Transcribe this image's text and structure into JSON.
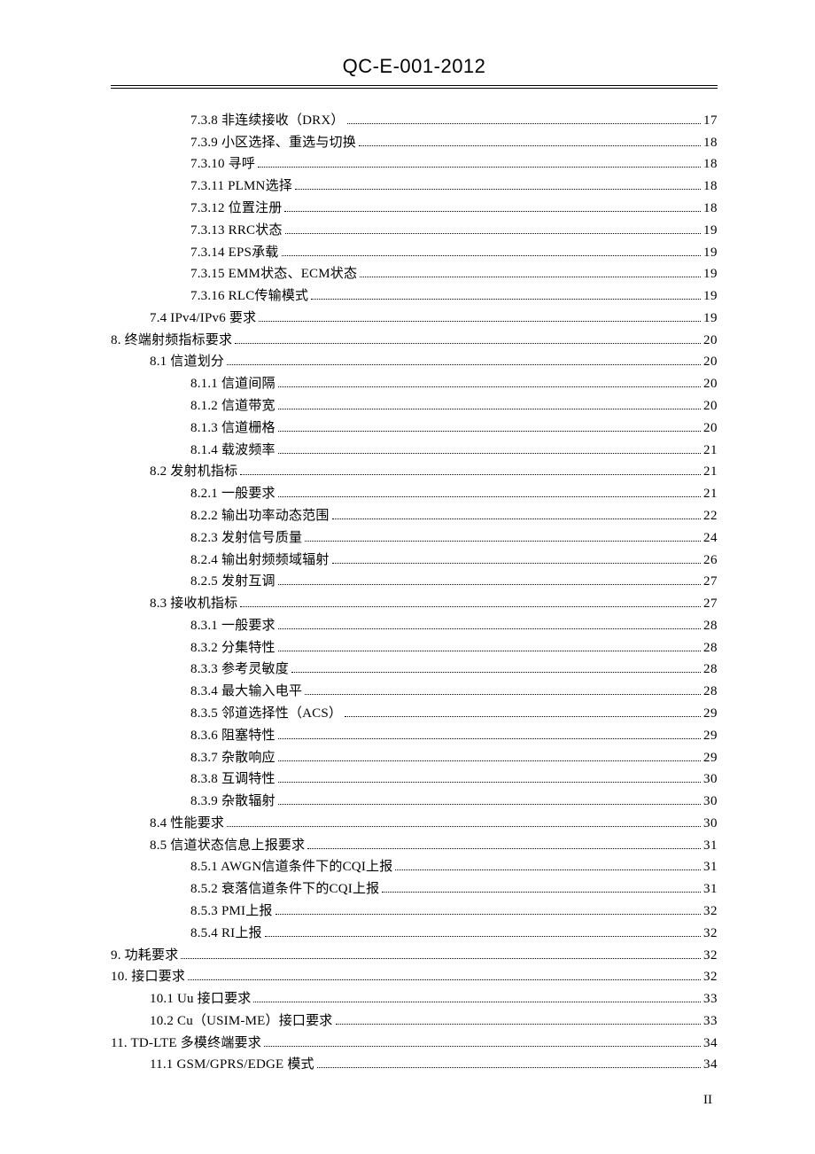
{
  "header": "QC-E-001-2012",
  "page_number": "II",
  "toc": [
    {
      "level": 3,
      "label": "7.3.8 非连续接收（DRX）",
      "page": "17"
    },
    {
      "level": 3,
      "label": "7.3.9 小区选择、重选与切换",
      "page": "18"
    },
    {
      "level": 3,
      "label": "7.3.10 寻呼",
      "page": "18"
    },
    {
      "level": 3,
      "label": "7.3.11 PLMN选择",
      "page": "18"
    },
    {
      "level": 3,
      "label": "7.3.12 位置注册",
      "page": "18"
    },
    {
      "level": 3,
      "label": "7.3.13 RRC状态",
      "page": "19"
    },
    {
      "level": 3,
      "label": "7.3.14 EPS承载",
      "page": "19"
    },
    {
      "level": 3,
      "label": "7.3.15 EMM状态、ECM状态",
      "page": "19"
    },
    {
      "level": 3,
      "label": "7.3.16 RLC传输模式",
      "page": "19"
    },
    {
      "level": 2,
      "label": "7.4 IPv4/IPv6 要求",
      "page": "19"
    },
    {
      "level": 1,
      "label": "8. 终端射频指标要求",
      "page": "20"
    },
    {
      "level": 2,
      "label": "8.1 信道划分",
      "page": "20"
    },
    {
      "level": 3,
      "label": "8.1.1 信道间隔",
      "page": "20"
    },
    {
      "level": 3,
      "label": "8.1.2 信道带宽",
      "page": "20"
    },
    {
      "level": 3,
      "label": "8.1.3 信道栅格",
      "page": "20"
    },
    {
      "level": 3,
      "label": "8.1.4 载波频率",
      "page": "21"
    },
    {
      "level": 2,
      "label": "8.2 发射机指标",
      "page": "21"
    },
    {
      "level": 3,
      "label": "8.2.1 一般要求",
      "page": "21"
    },
    {
      "level": 3,
      "label": "8.2.2 输出功率动态范围",
      "page": "22"
    },
    {
      "level": 3,
      "label": "8.2.3 发射信号质量",
      "page": "24"
    },
    {
      "level": 3,
      "label": "8.2.4 输出射频频域辐射",
      "page": "26"
    },
    {
      "level": 3,
      "label": "8.2.5 发射互调",
      "page": "27"
    },
    {
      "level": 2,
      "label": "8.3 接收机指标",
      "page": "27"
    },
    {
      "level": 3,
      "label": "8.3.1 一般要求",
      "page": "28"
    },
    {
      "level": 3,
      "label": "8.3.2 分集特性",
      "page": "28"
    },
    {
      "level": 3,
      "label": "8.3.3 参考灵敏度",
      "page": "28"
    },
    {
      "level": 3,
      "label": "8.3.4 最大输入电平",
      "page": "28"
    },
    {
      "level": 3,
      "label": "8.3.5 邻道选择性（ACS）",
      "page": "29"
    },
    {
      "level": 3,
      "label": "8.3.6 阻塞特性",
      "page": "29"
    },
    {
      "level": 3,
      "label": "8.3.7 杂散响应",
      "page": "29"
    },
    {
      "level": 3,
      "label": "8.3.8 互调特性",
      "page": "30"
    },
    {
      "level": 3,
      "label": "8.3.9 杂散辐射",
      "page": "30"
    },
    {
      "level": 2,
      "label": "8.4 性能要求",
      "page": "30"
    },
    {
      "level": 2,
      "label": "8.5 信道状态信息上报要求",
      "page": "31"
    },
    {
      "level": 3,
      "label": "8.5.1 AWGN信道条件下的CQI上报",
      "page": "31"
    },
    {
      "level": 3,
      "label": "8.5.2 衰落信道条件下的CQI上报",
      "page": "31"
    },
    {
      "level": 3,
      "label": "8.5.3 PMI上报",
      "page": "32"
    },
    {
      "level": 3,
      "label": "8.5.4 RI上报",
      "page": "32"
    },
    {
      "level": 1,
      "label": "9. 功耗要求",
      "page": "32"
    },
    {
      "level": 1,
      "label": "10. 接口要求",
      "page": "32"
    },
    {
      "level": 2,
      "label": "10.1 Uu 接口要求",
      "page": "33"
    },
    {
      "level": 2,
      "label": "10.2 Cu（USIM-ME）接口要求",
      "page": "33"
    },
    {
      "level": 1,
      "label": "11. TD-LTE 多模终端要求",
      "page": "34"
    },
    {
      "level": 2,
      "label": "11.1 GSM/GPRS/EDGE 模式",
      "page": "34"
    }
  ]
}
